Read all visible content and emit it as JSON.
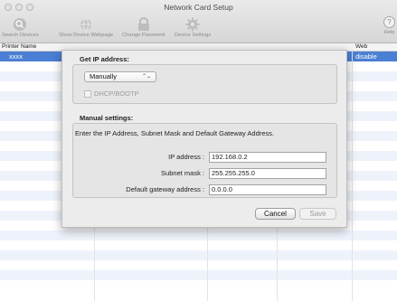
{
  "window": {
    "title": "Network Card Setup"
  },
  "toolbar": {
    "items": [
      {
        "label": "Search Devices",
        "icon": "search-icon"
      },
      {
        "label": "Show Device Webpage",
        "icon": "globe-icon"
      },
      {
        "label": "Change Password",
        "icon": "lock-icon"
      },
      {
        "label": "Device Settings",
        "icon": "gear-icon"
      }
    ],
    "help_glyph": "?",
    "help_label": "Help"
  },
  "table": {
    "headers": [
      "Printer Name",
      "Web"
    ],
    "selected_row": {
      "name": "xxxx",
      "web": "disable"
    }
  },
  "dialog": {
    "get_ip_label": "Get IP address:",
    "method_value": "Manually",
    "method_arrows": "⌃⌄",
    "dhcp_label": "DHCP/BOOTP",
    "manual_label": "Manual settings:",
    "description": "Enter the IP Address, Subnet Mask and Default Gateway Address.",
    "fields": [
      {
        "label": "IP address :",
        "value": "192.168.0.2"
      },
      {
        "label": "Subnet mask :",
        "value": "255.255.255.0"
      },
      {
        "label": "Default gateway address :",
        "value": "0.0.0.0"
      }
    ],
    "cancel_label": "Cancel",
    "save_label": "Save"
  }
}
